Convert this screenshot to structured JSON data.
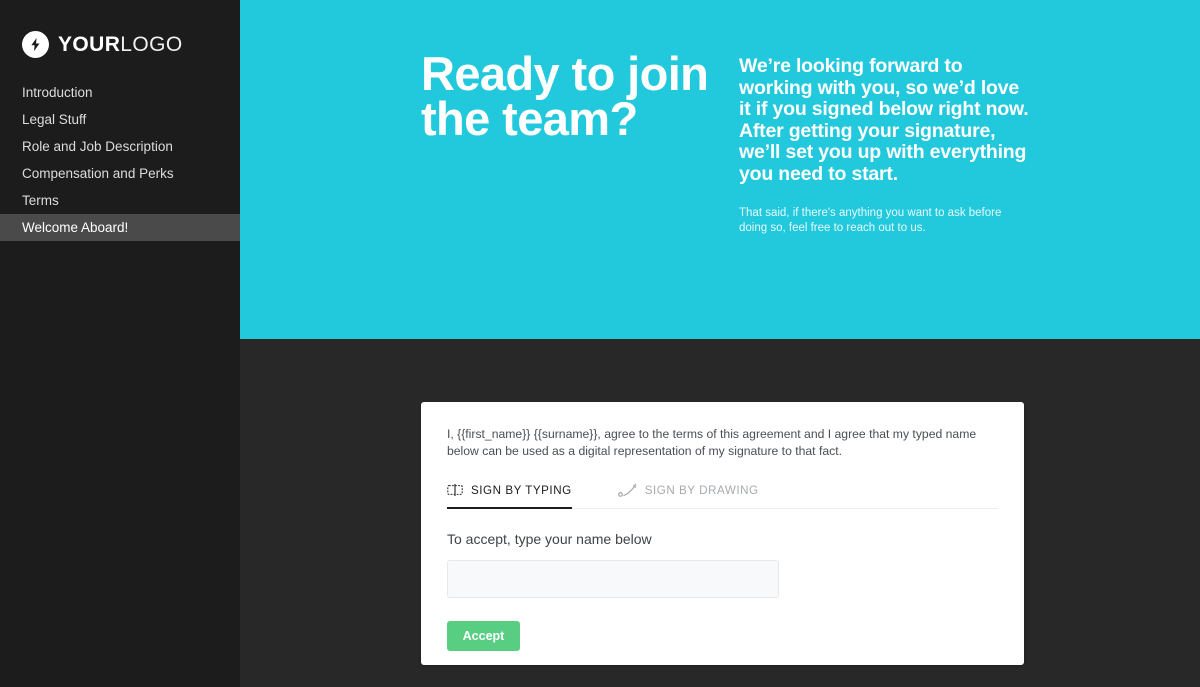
{
  "colors": {
    "sidebar_bg": "#1c1c1c",
    "sidebar_active_bg": "#4a4a4a",
    "page_bg": "#282828",
    "hero_bg": "#22c8dc",
    "accent_green": "#57ce82",
    "card_bg": "#ffffff",
    "input_bg": "#f8f9fa"
  },
  "sidebar": {
    "brand": {
      "icon": "lightning-bolt-icon",
      "text_strong": "YOUR",
      "text_light": "LOGO"
    },
    "items": [
      {
        "label": "Introduction",
        "active": false
      },
      {
        "label": "Legal Stuff",
        "active": false
      },
      {
        "label": "Role and Job Description",
        "active": false
      },
      {
        "label": "Compensation and Perks",
        "active": false
      },
      {
        "label": "Terms",
        "active": false
      },
      {
        "label": "Welcome Aboard!",
        "active": true
      }
    ]
  },
  "hero": {
    "title": "Ready to join the team?",
    "lead": "We’re looking forward to working with you, so we’d love it if you signed below right now. After getting your signature, we’ll set you up with everything you need to start.",
    "sub": "That said, if there's anything you want to ask before doing so, feel free to reach out to us."
  },
  "card": {
    "agreement": "I, {{first_name}} {{surname}}, agree to the terms of this agreement and I agree that my typed name below can be used as a digital representation of my signature to that fact.",
    "tabs": [
      {
        "label": "SIGN BY TYPING",
        "icon": "keyboard-typing-icon",
        "active": true
      },
      {
        "label": "SIGN BY DRAWING",
        "icon": "pen-nib-icon",
        "active": false
      }
    ],
    "field_label": "To accept, type your name below",
    "signature_value": "",
    "signature_placeholder": "",
    "accept_label": "Accept"
  }
}
